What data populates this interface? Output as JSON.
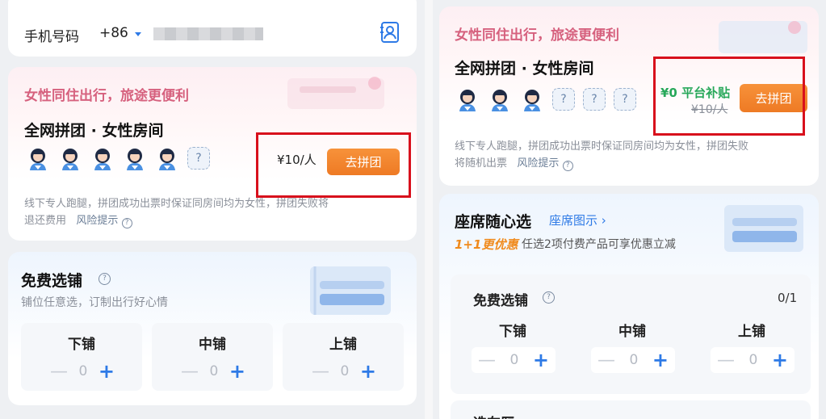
{
  "left": {
    "phone": {
      "label": "手机号码",
      "country_code": "+86"
    },
    "group": {
      "slogan": "女性同住出行，旅途更便利",
      "title": "全网拼团 · 女性房间",
      "price": "¥10/人",
      "button": "去拼团",
      "desc_line1": "线下专人跑腿，拼团成功出票时保证同房间均为女性，拼团失败将",
      "desc_line2": "退还费用",
      "risk_link": "风险提示",
      "avatars_filled": 5,
      "avatars_empty": 1,
      "empty_mark": "?"
    },
    "berth_section": {
      "title": "免费选铺",
      "subtitle": "铺位任意选，订制出行好心情",
      "berths": [
        {
          "label": "下铺",
          "value": "0"
        },
        {
          "label": "中铺",
          "value": "0"
        },
        {
          "label": "上铺",
          "value": "0"
        }
      ]
    }
  },
  "right": {
    "group": {
      "slogan": "女性同住出行，旅途更便利",
      "title": "全网拼团 · 女性房间",
      "subsidy": "¥0 平台补贴",
      "orig_price": "¥10/人",
      "button": "去拼团",
      "desc_line1": "线下专人跑腿，拼团成功出票时保证同房间均为女性，拼团失败",
      "desc_line2": "将随机出票",
      "risk_link": "风险提示",
      "avatars_filled": 3,
      "avatars_empty": 3,
      "empty_mark": "?"
    },
    "seat_section": {
      "title": "座席随心选",
      "map_link": "座席图示 ›",
      "promo_tag": "1+1更优惠",
      "promo_text": "任选2项付费产品可享优惠立减",
      "inner_title": "免费选铺",
      "count": "0/1",
      "berths": [
        {
          "label": "下铺",
          "value": "0"
        },
        {
          "label": "中铺",
          "value": "0"
        },
        {
          "label": "上铺",
          "value": "0"
        }
      ],
      "next_title_partial": "选车厢"
    }
  },
  "stepper": {
    "minus": "—",
    "plus": "+"
  },
  "colors": {
    "accent_orange": "#ee7a24",
    "accent_blue": "#2e7ae6",
    "slogan_pink": "#d6617e",
    "subsidy_green": "#27a85a",
    "highlight_red": "#d8101c"
  }
}
